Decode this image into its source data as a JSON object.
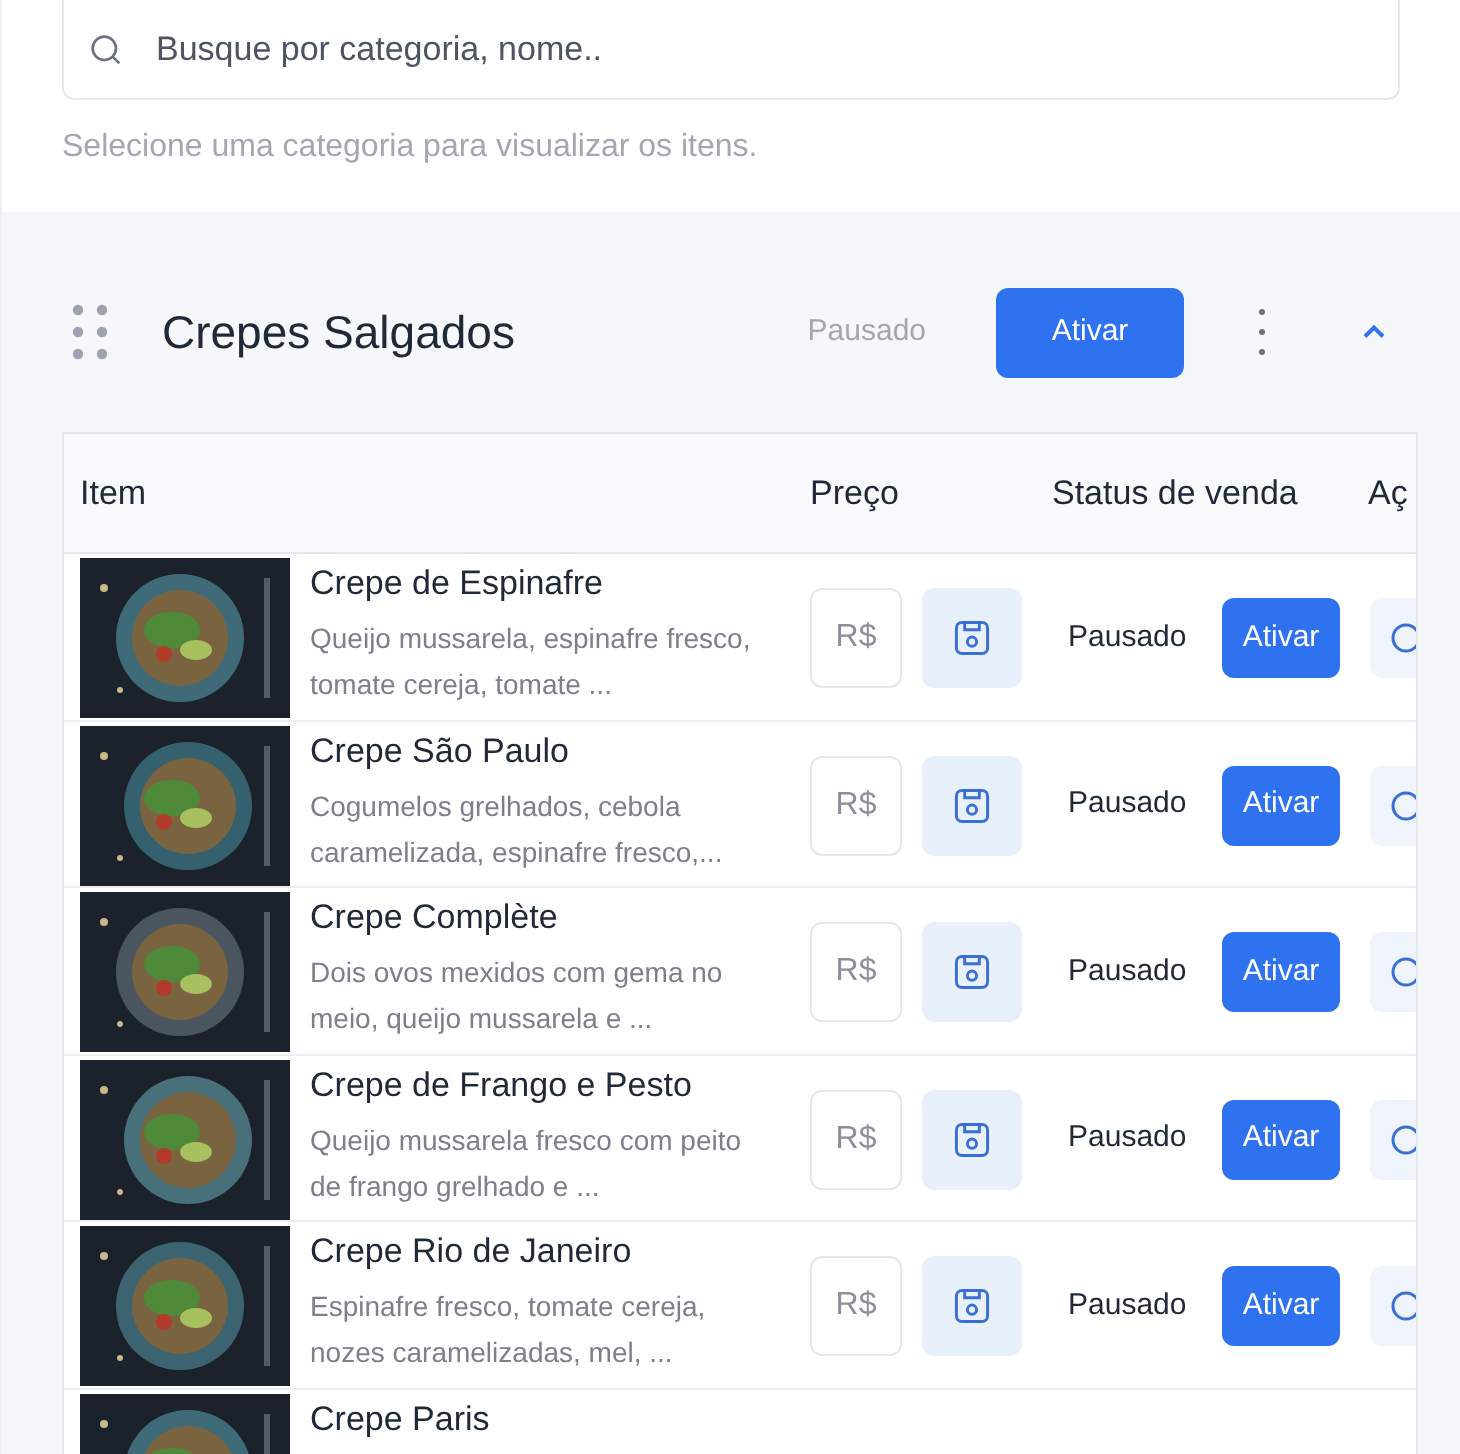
{
  "search": {
    "placeholder": "Busque por categoria, nome.."
  },
  "hint": "Selecione uma categoria para visualizar os itens.",
  "category": {
    "title": "Crepes Salgados",
    "status": "Pausado",
    "action": "Ativar",
    "expanded": true
  },
  "table": {
    "columns": [
      "Item",
      "Preço",
      "Status de venda",
      "Aç"
    ],
    "rows": [
      {
        "name": "Crepe de Espinafre",
        "description": "Queijo mussarela, espinafre fresco, tomate cereja, tomate ...",
        "price_placeholder": "R$",
        "status": "Pausado",
        "action": "Ativar"
      },
      {
        "name": "Crepe São Paulo",
        "description": "Cogumelos grelhados, cebola caramelizada, espinafre fresco,...",
        "price_placeholder": "R$",
        "status": "Pausado",
        "action": "Ativar"
      },
      {
        "name": "Crepe Complète",
        "description": "Dois ovos mexidos com gema no meio, queijo mussarela e ...",
        "price_placeholder": "R$",
        "status": "Pausado",
        "action": "Ativar"
      },
      {
        "name": "Crepe de Frango e Pesto",
        "description": "Queijo mussarela fresco com peito de frango grelhado e ...",
        "price_placeholder": "R$",
        "status": "Pausado",
        "action": "Ativar"
      },
      {
        "name": "Crepe Rio de Janeiro",
        "description": "Espinafre fresco, tomate cereja, nozes caramelizadas, mel, ...",
        "price_placeholder": "R$",
        "status": "Pausado",
        "action": "Ativar"
      },
      {
        "name": "Crepe Paris"
      }
    ]
  }
}
